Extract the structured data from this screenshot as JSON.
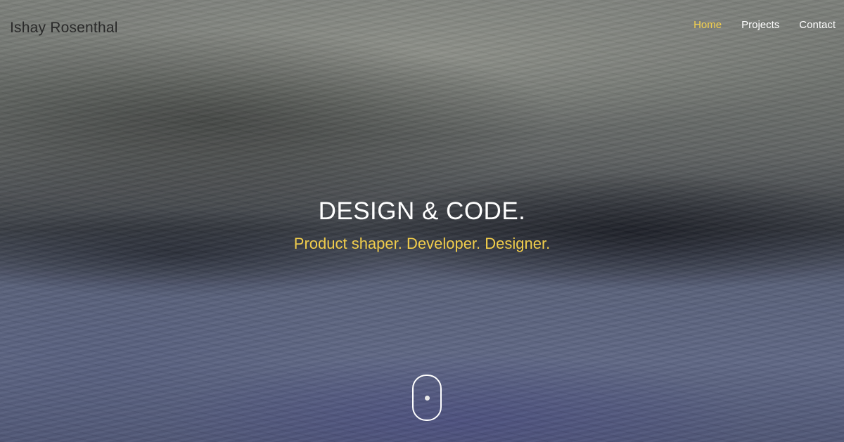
{
  "brand": {
    "name": "Ishay Rosenthal"
  },
  "nav": {
    "items": [
      {
        "label": "Home",
        "active": true
      },
      {
        "label": "Projects",
        "active": false
      },
      {
        "label": "Contact",
        "active": false
      }
    ]
  },
  "hero": {
    "headline": "DESIGN & CODE.",
    "tagline": "Product shaper. Developer. Designer."
  },
  "scroll_indicator": {
    "icon": "mouse-scroll-icon"
  },
  "colors": {
    "accent": "#f4d04d",
    "text": "#ffffff",
    "brand_text": "#2a2a2a"
  }
}
